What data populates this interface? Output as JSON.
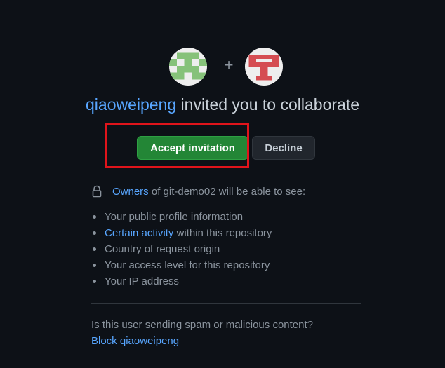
{
  "avatars": [
    {
      "name": "inviter-avatar",
      "color": "#86c27a",
      "bg": "#eeeeee"
    },
    {
      "name": "repo-owner-avatar",
      "color": "#d54d52",
      "bg": "#eeeeee"
    }
  ],
  "separator": "+",
  "headline": {
    "user": "qiaoweipeng",
    "text": " invited you to collaborate"
  },
  "buttons": {
    "accept": "Accept invitation",
    "decline": "Decline"
  },
  "owners": {
    "link": "Owners",
    "text": " of git-demo02 will be able to see:"
  },
  "visible_items": [
    {
      "link": "",
      "text": "Your public profile information"
    },
    {
      "link": "Certain activity",
      "text": " within this repository"
    },
    {
      "link": "",
      "text": "Country of request origin"
    },
    {
      "link": "",
      "text": "Your access level for this repository"
    },
    {
      "link": "",
      "text": "Your IP address"
    }
  ],
  "spam": {
    "question": "Is this user sending spam or malicious content?",
    "block_link": "Block qiaoweipeng"
  },
  "colors": {
    "background": "#0d1117",
    "accent_link": "#58a6ff",
    "accept_green": "#238636",
    "highlight_red": "#e0141b"
  }
}
